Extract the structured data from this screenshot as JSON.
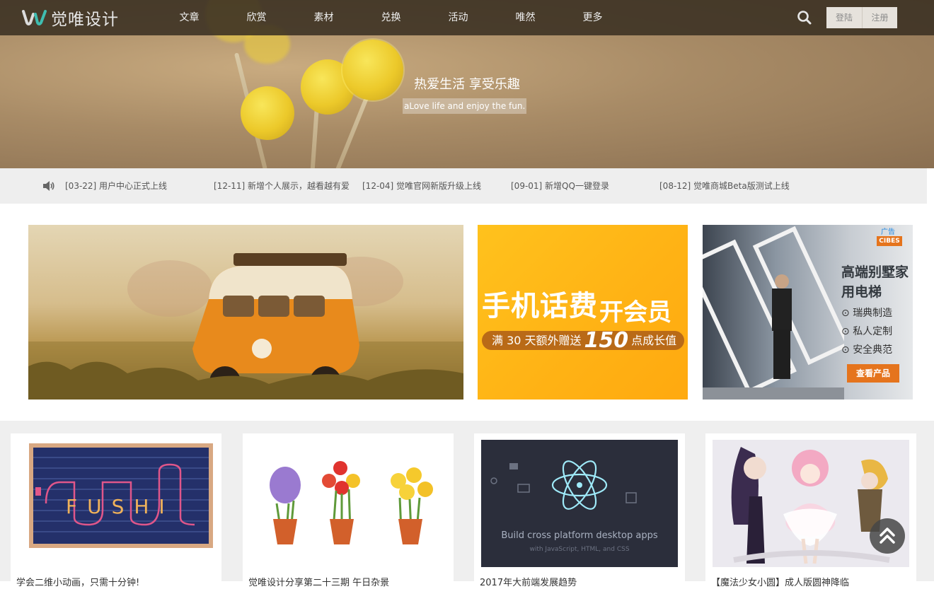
{
  "logo": {
    "text": "觉唯设计"
  },
  "nav": {
    "items": [
      {
        "label": "文章"
      },
      {
        "label": "欣赏"
      },
      {
        "label": "素材"
      },
      {
        "label": "兑换"
      },
      {
        "label": "活动"
      },
      {
        "label": "唯然"
      },
      {
        "label": "更多"
      }
    ],
    "login_label": "登陆",
    "register_label": "注册"
  },
  "hero": {
    "title": "热爱生活 享受乐趣",
    "subtitle": "aLove life and enjoy the fun."
  },
  "notices": [
    {
      "text": "[03-22] 用户中心正式上线"
    },
    {
      "text": "[12-11] 新增个人展示，越看越有爱"
    },
    {
      "text": "[12-04] 觉唯官网新版升级上线"
    },
    {
      "text": "[09-01] 新增QQ一键登录"
    },
    {
      "text": "[08-12] 觉唯商城Beta版测试上线"
    }
  ],
  "banners": {
    "phone": {
      "title": "手机话费",
      "title2": "开会员",
      "strip_pre": "满 30 天额外赠送",
      "strip_num": "150",
      "strip_post": "点成长值"
    },
    "ad": {
      "tag": "广告",
      "brand": "CIBES",
      "title": "高端别墅家用电梯",
      "features": [
        "瑞典制造",
        "私人定制",
        "安全典范"
      ],
      "button": "查看产品"
    }
  },
  "cards": [
    {
      "title": "学会二维小动画，只需十分钟!",
      "art_text": "FUSHI"
    },
    {
      "title": "觉唯设计分享第二十三期 午日杂景"
    },
    {
      "title": "2017年大前端发展趋势",
      "art_line1": "Build cross platform desktop apps",
      "art_line2": "with JavaScript, HTML, and CSS"
    },
    {
      "title": "【魔法少女小圆】成人版圆神降临"
    }
  ],
  "colors": {
    "nav_bg": "#3a3022",
    "accent_orange": "#e5741d",
    "phone_banner": "#ffb315",
    "page_gray": "#efefef"
  }
}
